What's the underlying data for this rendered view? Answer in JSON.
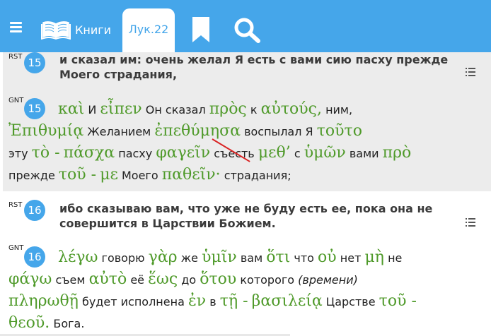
{
  "toolbar": {
    "books_label": "Книги",
    "chapter_label": "Лук.22",
    "icons": [
      "menu-icon",
      "book-icon",
      "bookmark-icon",
      "search-icon"
    ],
    "accent": "#45a6ea"
  },
  "verses": [
    {
      "number": "15",
      "rst_tag": "RST",
      "rst_lines": [
        "и сказал им: очень желал Я есть с вами сию пасху прежде",
        "Моего страдания,"
      ],
      "gnt_tag": "GNT",
      "gnt_lines": [
        [
          [
            "gr",
            "καὶ"
          ],
          [
            "ru",
            "И"
          ],
          [
            "gr",
            "εἶπεν"
          ],
          [
            "ru",
            "Он сказал"
          ],
          [
            "gr",
            "πρὸς"
          ],
          [
            "ru",
            "к"
          ],
          [
            "gr",
            "αὐτούς,"
          ],
          [
            "ru",
            "ним,"
          ]
        ],
        [
          [
            "gr",
            "Ἐπιθυμίᾳ"
          ],
          [
            "ru",
            "Желанием"
          ],
          [
            "gr",
            "ἐπεθύμησα"
          ],
          [
            "ru",
            "воспылал Я"
          ],
          [
            "gr",
            "τοῦτο"
          ]
        ],
        [
          [
            "ru",
            "эту"
          ],
          [
            "gr",
            "τὸ -"
          ],
          [
            "gr",
            "πάσχα"
          ],
          [
            "ru",
            "пасху"
          ],
          [
            "gr",
            "φαγεῖν"
          ],
          [
            "ru",
            "съесть"
          ],
          [
            "gr",
            "μεθ’"
          ],
          [
            "ru",
            "с"
          ],
          [
            "gr",
            "ὑμῶν"
          ],
          [
            "ru",
            "вами"
          ],
          [
            "gr",
            "πρὸ"
          ]
        ],
        [
          [
            "ru",
            "прежде"
          ],
          [
            "gr",
            "τοῦ -"
          ],
          [
            "gr",
            "με"
          ],
          [
            "ru",
            "Моего"
          ],
          [
            "gr",
            "παθεῖν·"
          ],
          [
            "ru",
            "страдания;"
          ]
        ]
      ]
    },
    {
      "number": "16",
      "rst_tag": "RST",
      "rst_lines": [
        "ибо сказываю вам, что уже не буду есть ее, пока она не",
        "совершится в Царствии Божием."
      ],
      "gnt_tag": "GNT",
      "gnt_lines": [
        [
          [
            "gr",
            "λέγω"
          ],
          [
            "ru",
            "говорю"
          ],
          [
            "gr",
            "γὰρ"
          ],
          [
            "ru",
            "же"
          ],
          [
            "gr",
            "ὑμῖν"
          ],
          [
            "ru",
            "вам"
          ],
          [
            "gr",
            "ὅτι"
          ],
          [
            "ru",
            "что"
          ],
          [
            "gr",
            "οὐ"
          ],
          [
            "ru",
            "нет"
          ],
          [
            "gr",
            "μὴ"
          ],
          [
            "ru",
            "не"
          ]
        ],
        [
          [
            "gr",
            "φάγω"
          ],
          [
            "ru",
            "съем"
          ],
          [
            "gr",
            "αὐτὸ"
          ],
          [
            "ru",
            "её"
          ],
          [
            "gr",
            "ἕως"
          ],
          [
            "ru",
            "до"
          ],
          [
            "gr",
            "ὅτου"
          ],
          [
            "ru",
            "которого"
          ],
          [
            "it",
            "(времени)"
          ]
        ],
        [
          [
            "gr",
            "πληρωθῇ"
          ],
          [
            "ru",
            "будет исполнена"
          ],
          [
            "gr",
            "ἐν"
          ],
          [
            "ru",
            "в"
          ],
          [
            "gr",
            "τῇ -"
          ],
          [
            "gr",
            "βασιλείᾳ"
          ],
          [
            "ru",
            "Царстве"
          ],
          [
            "gr",
            "τοῦ -"
          ]
        ],
        [
          [
            "gr",
            "θεοῦ."
          ],
          [
            "ru",
            "Бога."
          ]
        ]
      ]
    }
  ]
}
